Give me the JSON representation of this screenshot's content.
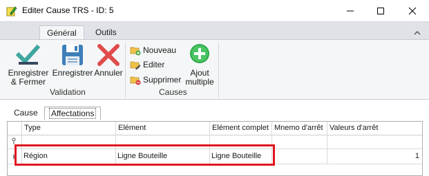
{
  "window": {
    "title": "Editer Cause TRS - ID: 5"
  },
  "ribbon": {
    "tabs": [
      {
        "label": "Général",
        "active": true
      },
      {
        "label": "Outils",
        "active": false
      }
    ],
    "groups": {
      "validation": {
        "label": "Validation",
        "buttons": {
          "save_close": {
            "line1": "Enregistrer",
            "line2": "& Fermer"
          },
          "save": "Enregistrer",
          "cancel": "Annuler"
        }
      },
      "causes": {
        "label": "Causes",
        "new": "Nouveau",
        "edit": "Editer",
        "delete": "Supprimer",
        "multi_add": {
          "line1": "Ajout",
          "line2": "multiple"
        }
      }
    }
  },
  "subtabs": [
    {
      "label": "Cause",
      "active": false
    },
    {
      "label": "Affectations",
      "active": true
    }
  ],
  "grid": {
    "columns": [
      "Type",
      "Elément",
      "Elément complet",
      "Mnemo d'arrêt",
      "Valeurs d'arrêt"
    ],
    "rows": [
      {
        "type": "Région",
        "element": "Ligne Bouteille",
        "element_full": "Ligne Bouteille",
        "mnemo": "",
        "values": "1"
      }
    ]
  },
  "colors": {
    "highlight": "#e1141e",
    "ribbon_bg": "#f5f6f7",
    "tabstrip_bg": "#dfe3e8"
  }
}
